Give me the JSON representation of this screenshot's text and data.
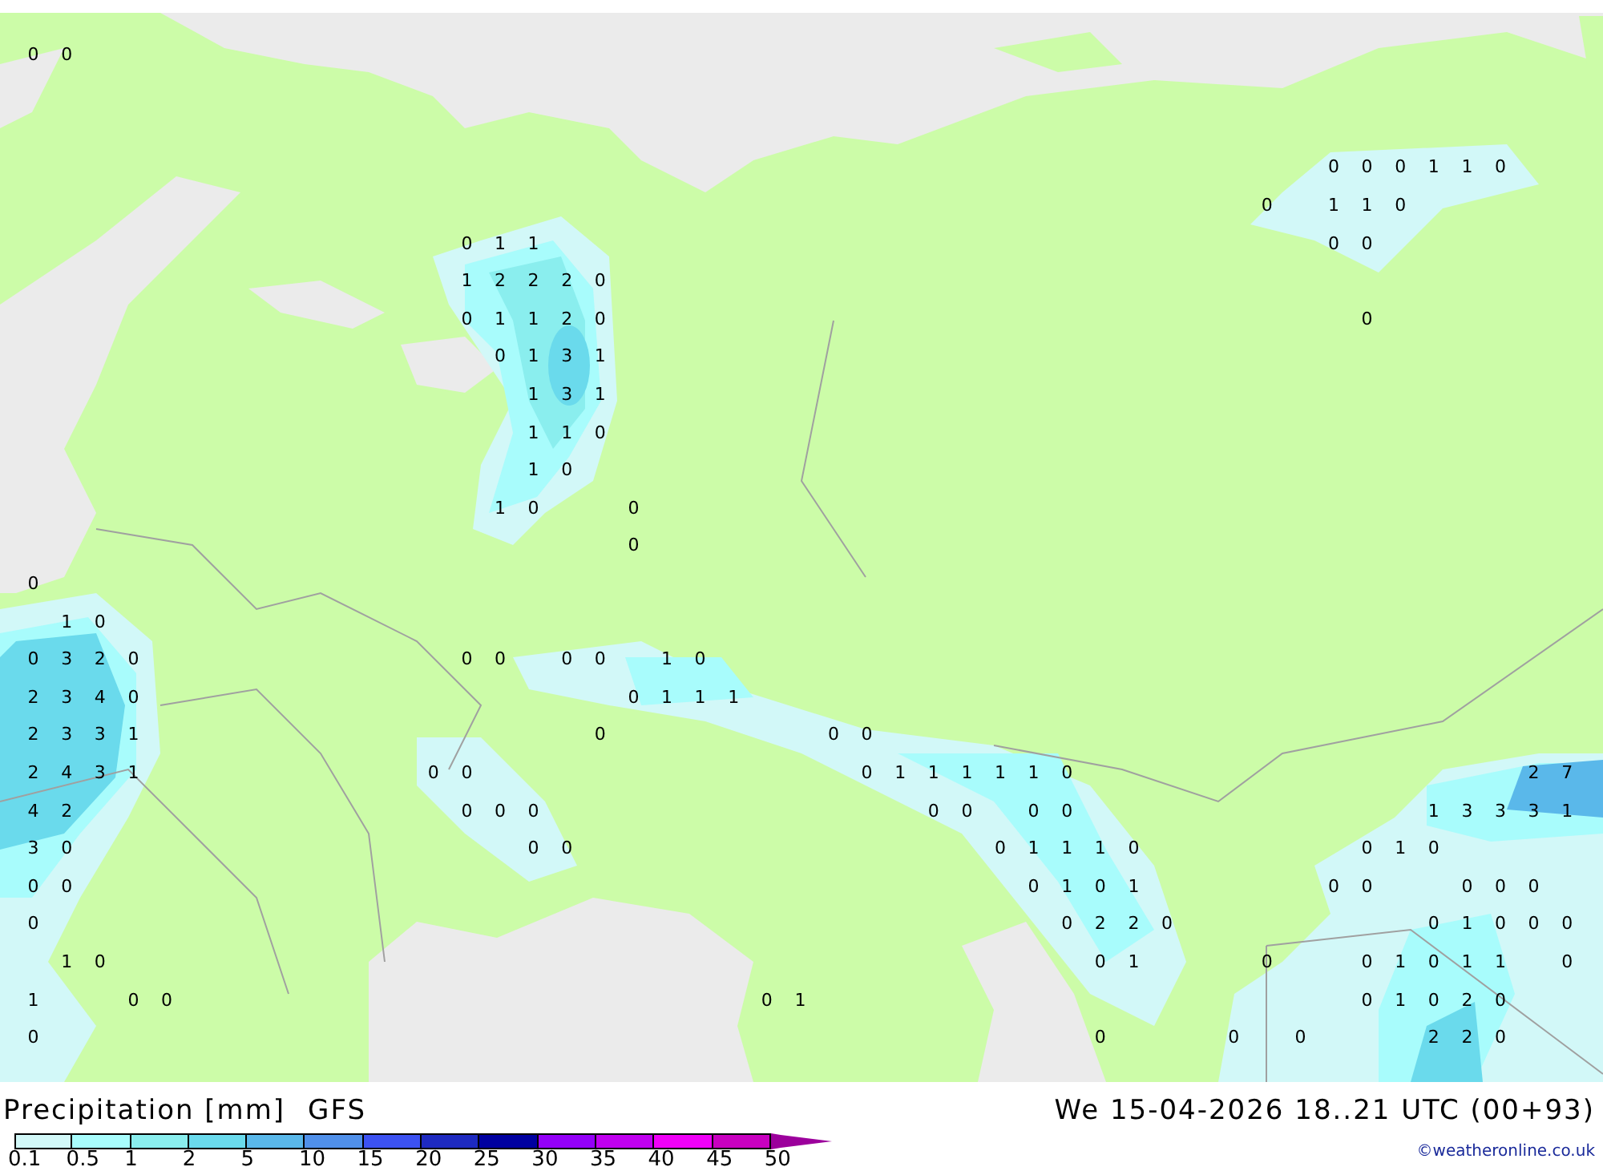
{
  "map": {
    "value_rows": [
      [
        "0",
        "0"
      ],
      [
        "0",
        "0",
        "0",
        "1",
        "1",
        "0"
      ],
      [
        "0",
        "1",
        "1",
        "0"
      ],
      [
        "0",
        "1",
        "1",
        "0",
        "0"
      ],
      [
        "1",
        "2",
        "2",
        "2",
        "0"
      ],
      [
        "0",
        "1",
        "1",
        "2",
        "0",
        "0"
      ],
      [
        "0",
        "1",
        "3",
        "1"
      ],
      [
        "1",
        "3",
        "1"
      ],
      [
        "1",
        "1",
        "0"
      ],
      [
        "1",
        "0"
      ],
      [
        "1",
        "0",
        "0"
      ],
      [
        "0"
      ],
      [
        "0"
      ],
      [
        "1",
        "0"
      ],
      [
        "0",
        "3",
        "2",
        "0",
        "0",
        "0",
        "0",
        "0",
        "1",
        "0"
      ],
      [
        "2",
        "3",
        "4",
        "0",
        "0",
        "1",
        "1",
        "1"
      ],
      [
        "2",
        "3",
        "3",
        "1",
        "0",
        "0",
        "0"
      ],
      [
        "2",
        "4",
        "3",
        "1",
        "0",
        "0",
        "0",
        "1",
        "1",
        "1",
        "1",
        "1",
        "0",
        "2",
        "7"
      ],
      [
        "4",
        "2",
        "0",
        "0",
        "0",
        "0",
        "0",
        "0",
        "0",
        "1",
        "3",
        "3",
        "3",
        "1"
      ],
      [
        "3",
        "0",
        "0",
        "0",
        "0",
        "1",
        "1",
        "1",
        "0",
        "0",
        "1",
        "0"
      ],
      [
        "0",
        "0",
        "0",
        "1",
        "0",
        "1",
        "0",
        "0",
        "0",
        "0",
        "0"
      ],
      [
        "0",
        "0",
        "2",
        "2",
        "0",
        "0",
        "1",
        "0",
        "0",
        "0"
      ],
      [
        "1",
        "0",
        "0",
        "1",
        "0",
        "0",
        "1",
        "0",
        "1",
        "1",
        "0"
      ],
      [
        "1",
        "0",
        "0",
        "0",
        "1",
        "0",
        "1",
        "0",
        "2",
        "0"
      ],
      [
        "0",
        "0",
        "0",
        "0",
        "2",
        "2",
        "0"
      ]
    ]
  },
  "legend": {
    "title": "Precipitation [mm]",
    "model": "GFS",
    "bins": [
      {
        "color": "#d2f8f8",
        "label": "0.1"
      },
      {
        "color": "#a8fcfc",
        "label": "0.5"
      },
      {
        "color": "#8aeeee",
        "label": "1"
      },
      {
        "color": "#6adaec",
        "label": "2"
      },
      {
        "color": "#5ab8ea",
        "label": "5"
      },
      {
        "color": "#5090ea",
        "label": "10"
      },
      {
        "color": "#3c52f2",
        "label": "15"
      },
      {
        "color": "#1e2ac0",
        "label": "20"
      },
      {
        "color": "#0000a0",
        "label": "25"
      },
      {
        "color": "#9400f8",
        "label": "30"
      },
      {
        "color": "#c000f0",
        "label": "35"
      },
      {
        "color": "#f000f8",
        "label": "40"
      },
      {
        "color": "#c800c0",
        "label": "45"
      }
    ],
    "end_label": "50"
  },
  "valid_time": "We 15-04-2026 18..21 UTC (00+93)",
  "credit": "©weatheronline.co.uk"
}
